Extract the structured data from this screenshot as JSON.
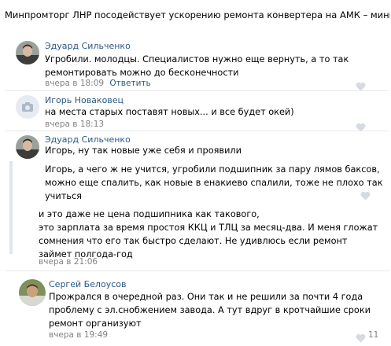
{
  "post": {
    "title": "Минпромторг ЛНР посодействует ускорению ремонта конвертера на АМК – министр"
  },
  "comments": [
    {
      "author": "Эдуард Сильченко",
      "lines": [
        "Угробили. молодцы. Специалистов нужно еще вернуть, а то так",
        "ремонтировать можно до бесконечности"
      ],
      "time": "вчера в 18:09",
      "reply": "Ответить"
    },
    {
      "author": "Игорь Новаковец",
      "lines": [
        "на места старых поставят новых... и все будет окей)"
      ],
      "time": "вчера в 18:13"
    },
    {
      "author": "Эдуард Сильченко",
      "lines": [
        "Игорь, ну так новые уже себя и проявили"
      ]
    },
    {
      "lines": [
        "Игорь, а чего ж не учится, угробили подшипник за пару лямов баксов,",
        "можно еще спалить, как новые в енакиево спалили, тоже не плохо так",
        "учиться"
      ]
    },
    {
      "lines": [
        "и это даже не цена подшипника как такового,",
        "это зарплата за время простоя ККЦ и ТЛЦ за месяц-два. И меня гложат",
        "сомнения что его так быстро сделают. Не удивлюсь если ремонт",
        "займет полгода-год"
      ],
      "time": "вчера в 21:06"
    },
    {
      "author": "Сергей Белоусов",
      "lines": [
        "Прожрался в очередной раз. Они так и не решили за почти 4 года",
        "проблему с эл.снобжением завода. А тут вдруг в кротчайшие сроки",
        "ремонт организуют"
      ],
      "time": "вчера в 19:49",
      "likes": "11"
    }
  ],
  "icons": {
    "like": "heart-icon",
    "camera": "camera-icon"
  },
  "colors": {
    "link": "#2a5885",
    "meta": "#828282",
    "heart": "#d6dbe2",
    "divider": "#e7e8ec"
  }
}
